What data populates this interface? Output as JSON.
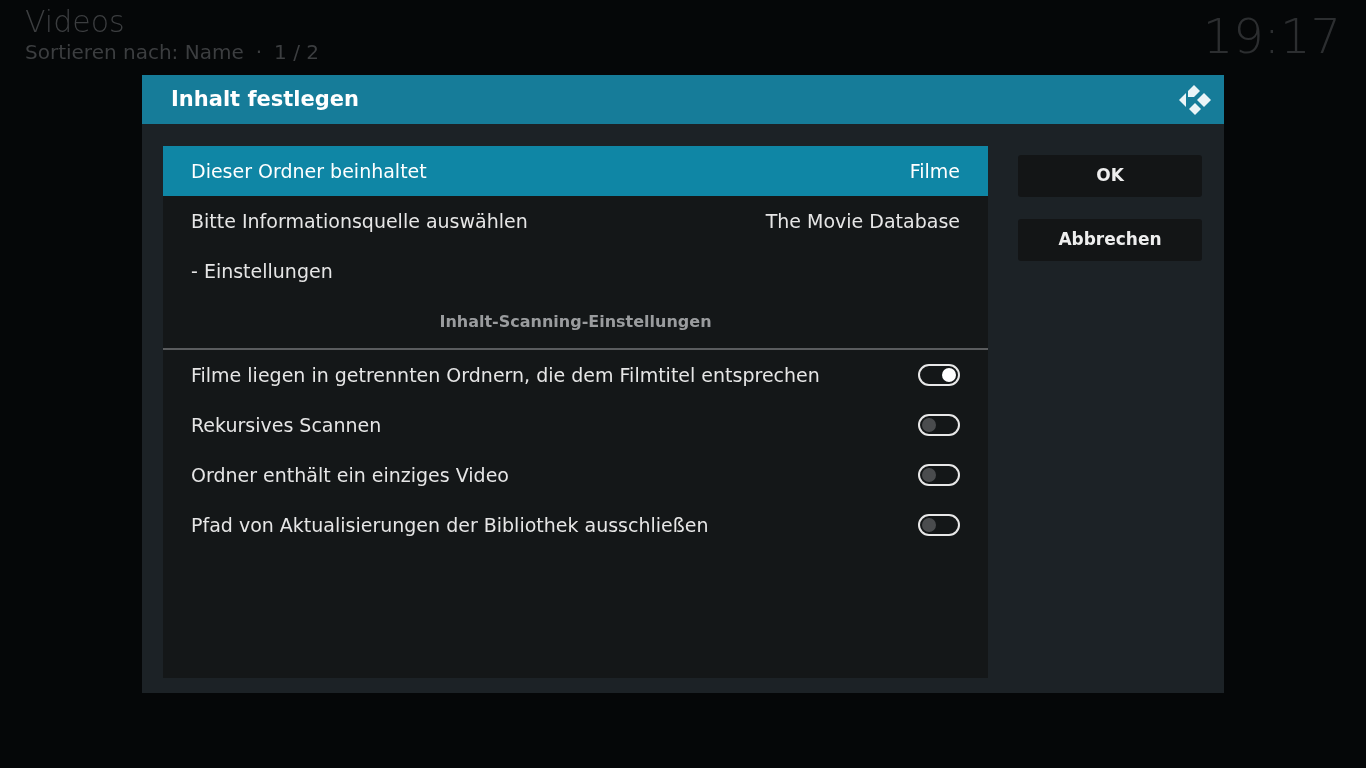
{
  "background": {
    "title": "Videos",
    "subtitle": "Sortieren nach: Name",
    "separator": "·",
    "page": "1 / 2",
    "clock": "19:17"
  },
  "dialog": {
    "title": "Inhalt festlegen",
    "items": [
      {
        "kind": "select",
        "label": "Dieser Ordner beinhaltet",
        "value": "Filme",
        "selected": true
      },
      {
        "kind": "select",
        "label": "Bitte Informationsquelle auswählen",
        "value": "The Movie Database",
        "selected": false
      },
      {
        "kind": "action",
        "label": "- Einstellungen",
        "selected": false
      },
      {
        "kind": "section",
        "label": "Inhalt-Scanning-Einstellungen"
      },
      {
        "kind": "toggle",
        "label": "Filme liegen in getrennten Ordnern, die dem Filmtitel entsprechen",
        "on": true,
        "selected": false
      },
      {
        "kind": "toggle",
        "label": "Rekursives Scannen",
        "on": false,
        "selected": false
      },
      {
        "kind": "toggle",
        "label": "Ordner enthält ein einziges Video",
        "on": false,
        "selected": false
      },
      {
        "kind": "toggle",
        "label": "Pfad von Aktualisierungen der Bibliothek ausschließen",
        "on": false,
        "selected": false
      }
    ],
    "buttons": [
      "OK",
      "Abbrechen"
    ]
  }
}
